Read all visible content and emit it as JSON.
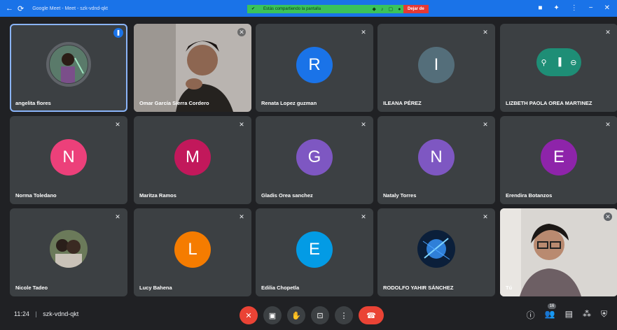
{
  "window": {
    "title": "Google Meet - Meet - szk-vdnd-qkt",
    "share_banner_text": "Estás compartiendo la pantalla",
    "stop_share_label": "Dejar de"
  },
  "tiles": [
    {
      "name": "angelita flores",
      "avatar_letter": "",
      "color": "#3c4043"
    },
    {
      "name": "Omar García Sierra Cordero",
      "avatar_letter": "",
      "color": "#3c4043"
    },
    {
      "name": "Renata Lopez guzman",
      "avatar_letter": "R",
      "color": "#1a73e8"
    },
    {
      "name": "ILEANA PÉREZ",
      "avatar_letter": "I",
      "color": "#546e7a"
    },
    {
      "name": "LIZBETH PAOLA OREA MARTINEZ",
      "avatar_letter": "",
      "color": "#00897b"
    },
    {
      "name": "Norma Toledano",
      "avatar_letter": "N",
      "color": "#ec407a"
    },
    {
      "name": "Maritza Ramos",
      "avatar_letter": "M",
      "color": "#c2185b"
    },
    {
      "name": "Gladis Orea sanchez",
      "avatar_letter": "G",
      "color": "#7e57c2"
    },
    {
      "name": "Nataly Torres",
      "avatar_letter": "N",
      "color": "#7e57c2"
    },
    {
      "name": "Erendira Botanzos",
      "avatar_letter": "E",
      "color": "#8e24aa"
    },
    {
      "name": "Nicole Tadeo",
      "avatar_letter": "",
      "color": "#3c4043"
    },
    {
      "name": "Lucy Bahena",
      "avatar_letter": "L",
      "color": "#f57c00"
    },
    {
      "name": "Edilia Chopetla",
      "avatar_letter": "E",
      "color": "#039be5"
    },
    {
      "name": "RODOLFO YAHIR SÁNCHEZ",
      "avatar_letter": "",
      "color": "#3c4043"
    },
    {
      "name": "Tú",
      "avatar_letter": "",
      "color": "#3c4043"
    }
  ],
  "bottom": {
    "time": "11:24",
    "meeting_code": "szk-vdnd-qkt",
    "participants_count": "16"
  }
}
